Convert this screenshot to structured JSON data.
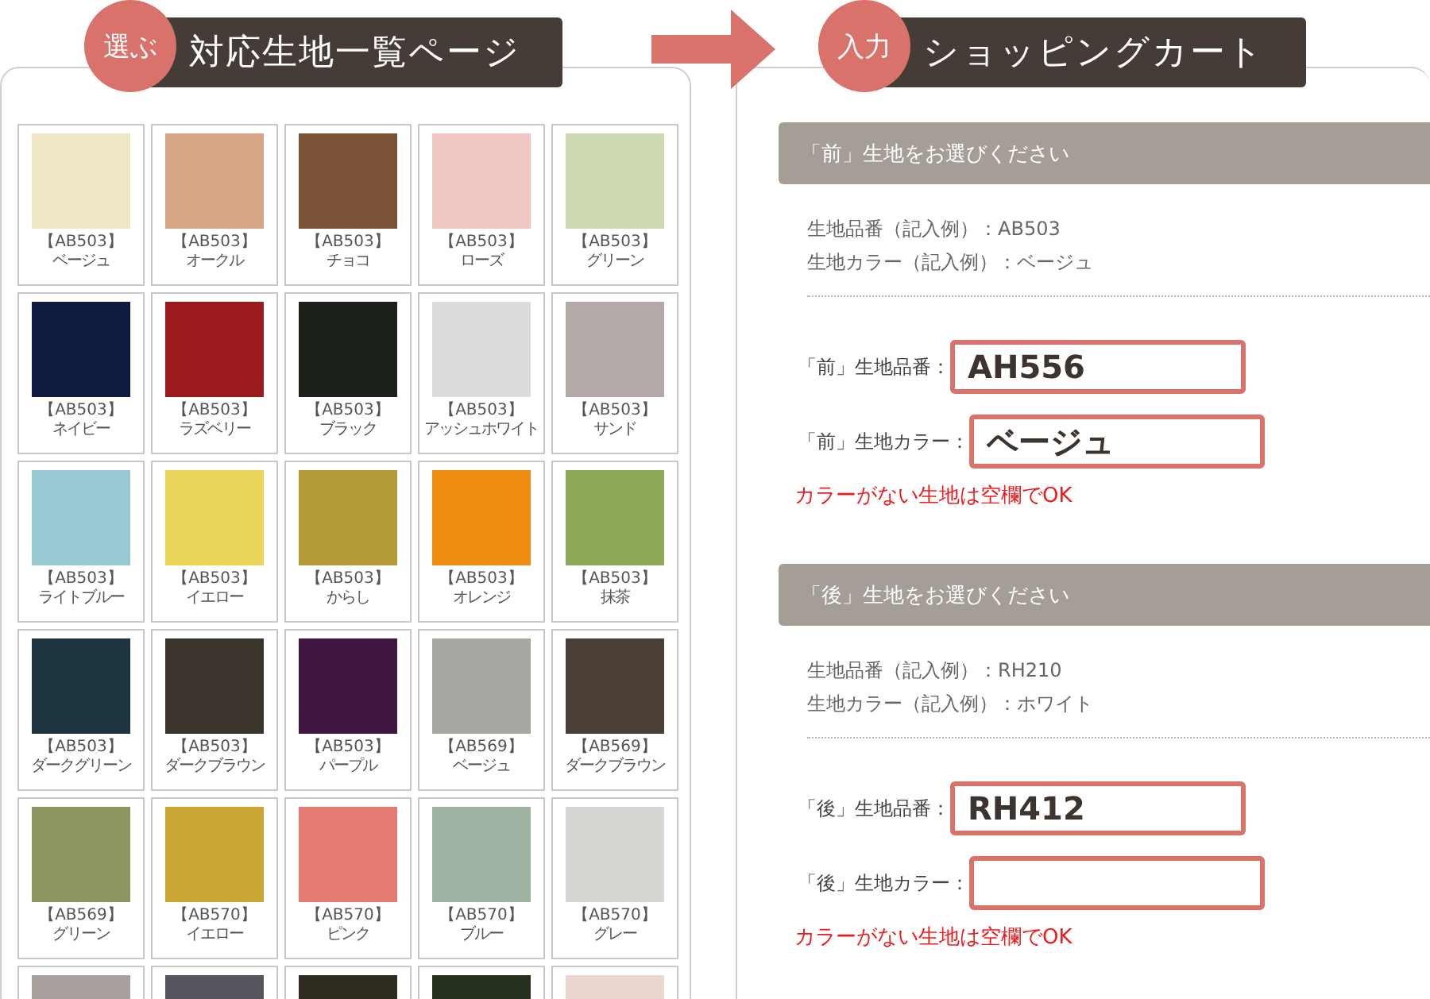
{
  "catalog": {
    "badge": "選ぶ",
    "title": "対応生地一覧ページ",
    "swatches": [
      {
        "code": "【AB503】",
        "name": "ベージュ",
        "color": "#efe6c3"
      },
      {
        "code": "【AB503】",
        "name": "オークル",
        "color": "#d8a687"
      },
      {
        "code": "【AB503】",
        "name": "チョコ",
        "color": "#7a5235"
      },
      {
        "code": "【AB503】",
        "name": "ローズ",
        "color": "#f0c6c4"
      },
      {
        "code": "【AB503】",
        "name": "グリーン",
        "color": "#cdd9b0"
      },
      {
        "code": "【AB503】",
        "name": "ネイビー",
        "color": "#111a40"
      },
      {
        "code": "【AB503】",
        "name": "ラズベリー",
        "color": "#9c1b1e"
      },
      {
        "code": "【AB503】",
        "name": "ブラック",
        "color": "#1c2119"
      },
      {
        "code": "【AB503】",
        "name": "アッシュホワイト",
        "color": "#dcdcdc"
      },
      {
        "code": "【AB503】",
        "name": "サンド",
        "color": "#b3aaa8"
      },
      {
        "code": "【AB503】",
        "name": "ライトブルー",
        "color": "#98c9d3"
      },
      {
        "code": "【AB503】",
        "name": "イエロー",
        "color": "#ead457"
      },
      {
        "code": "【AB503】",
        "name": "からし",
        "color": "#b59a38"
      },
      {
        "code": "【AB503】",
        "name": "オレンジ",
        "color": "#ef8d12"
      },
      {
        "code": "【AB503】",
        "name": "抹茶",
        "color": "#8fa95a"
      },
      {
        "code": "【AB503】",
        "name": "ダークグリーン",
        "color": "#1c3540"
      },
      {
        "code": "【AB503】",
        "name": "ダークブラウン",
        "color": "#3a342c"
      },
      {
        "code": "【AB503】",
        "name": "パープル",
        "color": "#3f1640"
      },
      {
        "code": "【AB569】",
        "name": "ベージュ",
        "color": "#a8a7a2"
      },
      {
        "code": "【AB569】",
        "name": "ダークブラウン",
        "color": "#4a4038"
      },
      {
        "code": "【AB569】",
        "name": "グリーン",
        "color": "#8c9560"
      },
      {
        "code": "【AB570】",
        "name": "イエロー",
        "color": "#cba635"
      },
      {
        "code": "【AB570】",
        "name": "ピンク",
        "color": "#e57a72"
      },
      {
        "code": "【AB570】",
        "name": "ブルー",
        "color": "#9fb1a0"
      },
      {
        "code": "【AB570】",
        "name": "グレー",
        "color": "#d6d6d2"
      },
      {
        "color": "#a8a09c"
      },
      {
        "color": "#56545c"
      },
      {
        "color": "#2e2a20"
      },
      {
        "color": "#26301f"
      },
      {
        "color": "#ecd6cf"
      }
    ]
  },
  "cart": {
    "badge": "入力",
    "title": "ショッピングカート",
    "sections": [
      {
        "heading": "「前」生地をお選びください",
        "examples": [
          "生地品番（記入例）：AB503",
          "生地カラー（記入例）：ベージュ"
        ],
        "fields": [
          {
            "label": "「前」生地品番：",
            "value": "AH556"
          },
          {
            "label": "「前」生地カラー：",
            "value": "ベージュ"
          }
        ],
        "note": "カラーがない生地は空欄でOK"
      },
      {
        "heading": "「後」生地をお選びください",
        "examples": [
          "生地品番（記入例）：RH210",
          "生地カラー（記入例）：ホワイト"
        ],
        "fields": [
          {
            "label": "「後」生地品番：",
            "value": "RH412"
          },
          {
            "label": "「後」生地カラー："
          }
        ],
        "note": "カラーがない生地は空欄でOK"
      }
    ]
  }
}
